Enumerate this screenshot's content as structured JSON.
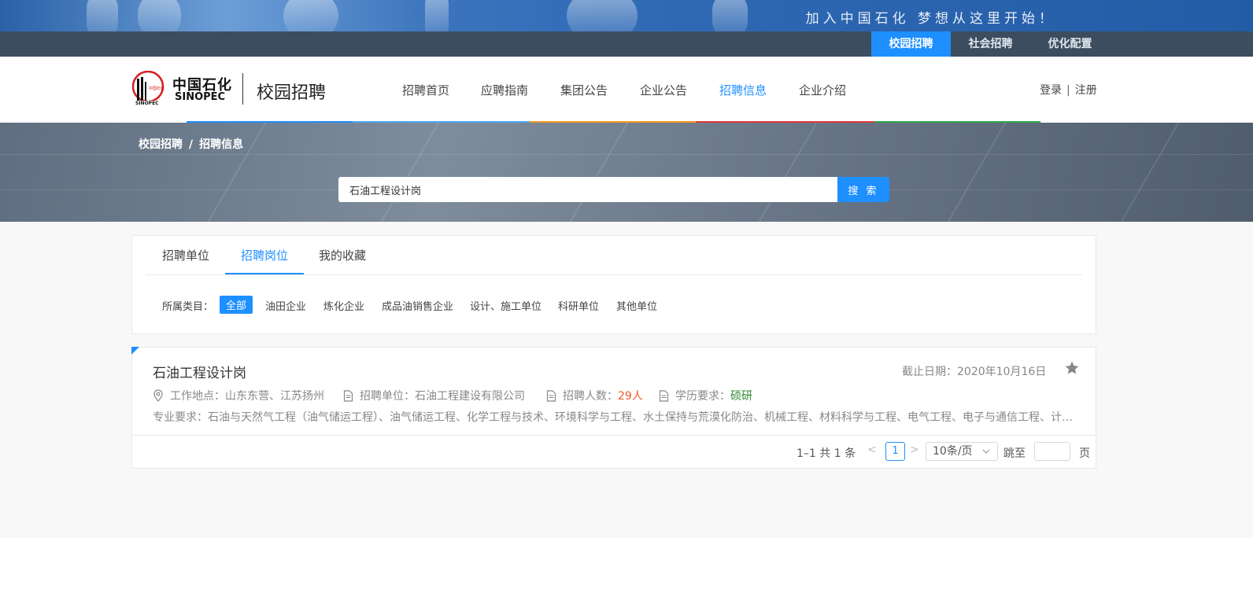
{
  "banner": {
    "slogan": "加入中国石化  梦想从这里开始！"
  },
  "subnav": {
    "items": [
      {
        "label": "校园招聘",
        "active": true
      },
      {
        "label": "社会招聘",
        "active": false
      },
      {
        "label": "优化配置",
        "active": false
      }
    ]
  },
  "header": {
    "brand_cn": "中国石化",
    "brand_en": "SINOPEC",
    "brand_sub": "校园招聘",
    "nav": [
      {
        "label": "招聘首页",
        "active": false
      },
      {
        "label": "应聘指南",
        "active": false
      },
      {
        "label": "集团公告",
        "active": false
      },
      {
        "label": "企业公告",
        "active": false
      },
      {
        "label": "招聘信息",
        "active": true
      },
      {
        "label": "企业介绍",
        "active": false
      }
    ],
    "login_label": "登录",
    "register_label": "注册",
    "auth_sep": "|"
  },
  "breadcrumb": {
    "items": [
      "校园招聘",
      "招聘信息"
    ],
    "sep": "/"
  },
  "search": {
    "value": "石油工程设计岗",
    "placeholder": "",
    "button_label": "搜 索"
  },
  "tabs": [
    {
      "label": "招聘单位",
      "active": false
    },
    {
      "label": "招聘岗位",
      "active": true
    },
    {
      "label": "我的收藏",
      "active": false
    }
  ],
  "categories": {
    "label": "所属类目：",
    "items": [
      {
        "label": "全部",
        "active": true
      },
      {
        "label": "油田企业",
        "active": false
      },
      {
        "label": "炼化企业",
        "active": false
      },
      {
        "label": "成品油销售企业",
        "active": false
      },
      {
        "label": "设计、施工单位",
        "active": false
      },
      {
        "label": "科研单位",
        "active": false
      },
      {
        "label": "其他单位",
        "active": false
      }
    ]
  },
  "job": {
    "title": "石油工程设计岗",
    "deadline": "截止日期：2020年10月16日",
    "location_label": "工作地点：",
    "location": "山东东营、江苏扬州",
    "unit_label": "招聘单位：",
    "unit": "石油工程建设有限公司",
    "count_label": "招聘人数：",
    "count": "29人",
    "edu_label": "学历要求：",
    "edu": "硕研",
    "major": "专业要求：石油与天然气工程（油气储运工程）、油气储运工程、化学工程与技术、环境科学与工程、水土保持与荒漠化防治、机械工程、材料科学与工程、电气工程、电子与通信工程、计算机科学与技术"
  },
  "pagination": {
    "summary": "1–1 共 1 条",
    "prev": "<",
    "current": "1",
    "next": ">",
    "page_size": "10条/页",
    "jump_label": "跳至",
    "page_suffix": "页"
  },
  "colors": {
    "accent": "#1e8fff",
    "subnav_bg": "#3d4d60",
    "count_color": "#f05a28",
    "edu_color": "#2d8a2d",
    "bar_blue": "#1e8fff",
    "bar_orange": "#f39c1d",
    "bar_red": "#e03b3b",
    "bar_green": "#2eaa4a"
  }
}
